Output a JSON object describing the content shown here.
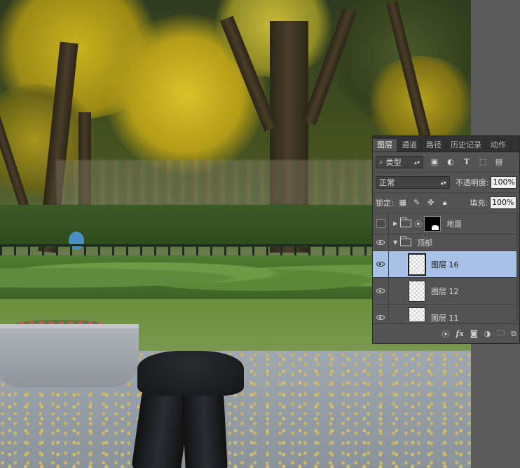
{
  "panel": {
    "tabs": [
      "图层",
      "通道",
      "路径",
      "历史记录",
      "动作"
    ],
    "active_tab": "图层",
    "filter": {
      "kind_label": "类型",
      "icons": [
        "image-filter-icon",
        "adjustment-filter-icon",
        "type-filter-icon",
        "shape-filter-icon",
        "smart-object-filter-icon"
      ]
    },
    "blend_mode": "正常",
    "opacity_label": "不透明度:",
    "opacity_value": "100%",
    "lock_label": "锁定:",
    "fill_label": "填充:",
    "fill_value": "100%",
    "layers": [
      {
        "name": "地面",
        "type": "group-with-mask",
        "visible": false,
        "selected": false,
        "collapsed": true
      },
      {
        "name": "顶部",
        "type": "group",
        "visible": true,
        "selected": false,
        "collapsed": false
      },
      {
        "name": "图层 16",
        "type": "layer",
        "visible": true,
        "selected": true
      },
      {
        "name": "图层 12",
        "type": "layer",
        "visible": true,
        "selected": false
      },
      {
        "name": "图层 11",
        "type": "layer",
        "visible": true,
        "selected": false
      }
    ],
    "footer_icons": [
      "link-icon",
      "fx-icon",
      "add-mask-icon",
      "adjustment-icon",
      "new-group-icon",
      "new-layer-icon"
    ],
    "fx_label": "fx",
    "selection_color": "#a9c0e6"
  }
}
